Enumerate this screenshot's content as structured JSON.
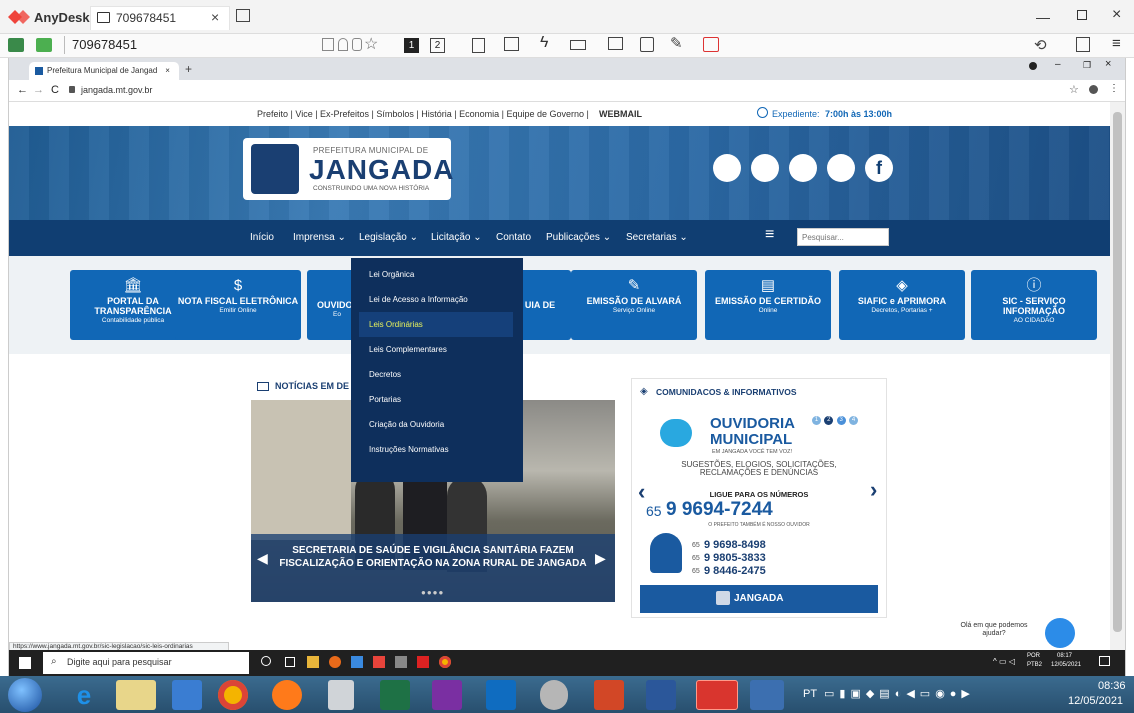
{
  "anydesk": {
    "brand": "AnyDesk",
    "tab_title": "709678451",
    "address_id": "709678451",
    "monitor_1": "1",
    "monitor_2": "2"
  },
  "browser": {
    "tab_title": "Prefeitura Municipal de Jangad",
    "url": "jangada.mt.gov.br",
    "status_url": "https://www.jangada.mt.gov.br/sic-legislacao/sic-leis-ordinarias"
  },
  "site": {
    "top_links": "Prefeito | Vice | Ex-Prefeitos | Símbolos | História | Economia | Equipe de Governo |",
    "webmail": "WEBMAIL",
    "hours_label": "Expediente:",
    "hours_value": "7:00h às 13:00h",
    "logo": {
      "line1": "PREFEITURA MUNICIPAL DE",
      "line2": "JANGADA",
      "line3": "CONSTRUINDO UMA NOVA HISTÓRIA"
    },
    "nav": [
      "Início",
      "Imprensa ⌄",
      "Legislação ⌄",
      "Licitação ⌄",
      "Contato",
      "Publicações ⌄",
      "Secretarias ⌄"
    ],
    "search_placeholder": "Pesquisar...",
    "cards": [
      {
        "title": "PORTAL DA TRANSPARÊNCIA",
        "sub": "Contabilidade pública",
        "icon": "bank-icon"
      },
      {
        "title": "NOTA FISCAL ELETRÔNICA",
        "sub": "Emitir Online",
        "icon": "invoice-icon"
      },
      {
        "title": "OUVIDO",
        "sub": "Eo",
        "icon": "megaphone-icon"
      },
      {
        "title": "UIA DE",
        "sub": "",
        "icon": "guide-icon"
      },
      {
        "title": "EMISSÃO DE ALVARÁ",
        "sub": "Serviço Online",
        "icon": "sign-icon"
      },
      {
        "title": "EMISSÃO DE CERTIDÃO",
        "sub": "Online",
        "icon": "document-icon"
      },
      {
        "title": "SIAFIC e APRIMORA",
        "sub": "Decretos, Portarias +",
        "icon": "layers-icon"
      },
      {
        "title": "SIC - SERVIÇO INFORMAÇÃO",
        "sub": "AO CIDADÃO",
        "icon": "info-icon"
      }
    ],
    "legislacao_menu": [
      "Lei Orgânica",
      "Lei de Acesso a Informação",
      "Leis Ordinárias",
      "Leis Complementares",
      "Decretos",
      "Portarias",
      "Criação da Ouvidoria",
      "Instruções Normativas"
    ],
    "news_heading": "NOTÍCIAS EM DE",
    "news_caption_1": "SECRETARIA DE SAÚDE E VIGILÂNCIA SANITÁRIA FAZEM",
    "news_caption_2": "FISCALIZAÇÃO E ORIENTAÇÃO NA ZONA RURAL DE JANGADA",
    "comm_heading": "COMUNIDACOS & INFORMATIVOS",
    "comm_banner": {
      "title1": "OUVIDORIA",
      "title2": "MUNICIPAL",
      "tagline": "EM JANGADA VOCÊ TEM VOZ!",
      "line1": "SUGESTÕES, ELOGIOS, SOLICITAÇÕES,",
      "line2": "RECLAMAÇÕES E DENÚNCIAS",
      "call": "LIGUE PARA OS NÚMEROS",
      "main_prefix": "65",
      "main_number": "9 9694-7244",
      "prefeito": "O PREFEITO TAMBÉM É NOSSO OUVIDOR",
      "n1_prefix": "65",
      "n1": "9 9698-8498",
      "n2_prefix": "65",
      "n2": "9 9805-3833",
      "n3_prefix": "65",
      "n3": "9 8446-2475",
      "footer": "JANGADA",
      "dots": [
        "1",
        "2",
        "3",
        "4"
      ]
    },
    "chat_text1": "Olá em que podemos",
    "chat_text2": "ajudar?"
  },
  "remote_taskbar": {
    "search": "Digite aqui para pesquisar",
    "lang1": "POR",
    "lang2": "PTB2",
    "time": "08:17",
    "date": "12/05/2021"
  },
  "local_taskbar": {
    "lang": "PT",
    "time": "08:36",
    "date": "12/05/2021"
  },
  "colors": {
    "navy": "#103e72",
    "card_blue": "#1167b6",
    "dropdown": "#0e2f5c",
    "highlight": "#e8f25c",
    "anydesk_red": "#ef443b"
  }
}
